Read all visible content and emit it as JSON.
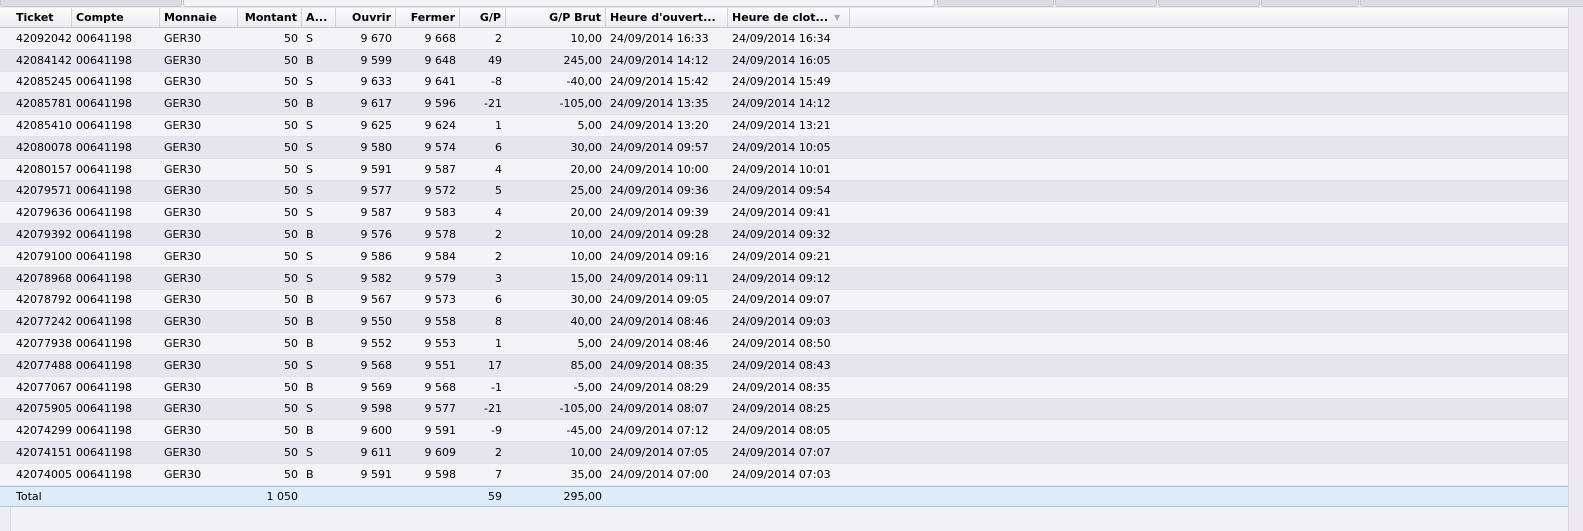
{
  "columns": [
    "Ticket",
    "Compte",
    "Monnaie",
    "Montant",
    "A...",
    "Ouvrir",
    "Fermer",
    "G/P",
    "G/P Brut",
    "Heure d'ouvert...",
    "Heure de clot..."
  ],
  "sort_icon": "▼",
  "rows": [
    [
      "42092042",
      "00641198",
      "GER30",
      "50",
      "S",
      "9 670",
      "9 668",
      "2",
      "10,00",
      "24/09/2014 16:33",
      "24/09/2014 16:34"
    ],
    [
      "42084142",
      "00641198",
      "GER30",
      "50",
      "B",
      "9 599",
      "9 648",
      "49",
      "245,00",
      "24/09/2014 14:12",
      "24/09/2014 16:05"
    ],
    [
      "42085245",
      "00641198",
      "GER30",
      "50",
      "S",
      "9 633",
      "9 641",
      "-8",
      "-40,00",
      "24/09/2014 15:42",
      "24/09/2014 15:49"
    ],
    [
      "42085781",
      "00641198",
      "GER30",
      "50",
      "B",
      "9 617",
      "9 596",
      "-21",
      "-105,00",
      "24/09/2014 13:35",
      "24/09/2014 14:12"
    ],
    [
      "42085410",
      "00641198",
      "GER30",
      "50",
      "S",
      "9 625",
      "9 624",
      "1",
      "5,00",
      "24/09/2014 13:20",
      "24/09/2014 13:21"
    ],
    [
      "42080078",
      "00641198",
      "GER30",
      "50",
      "S",
      "9 580",
      "9 574",
      "6",
      "30,00",
      "24/09/2014 09:57",
      "24/09/2014 10:05"
    ],
    [
      "42080157",
      "00641198",
      "GER30",
      "50",
      "S",
      "9 591",
      "9 587",
      "4",
      "20,00",
      "24/09/2014 10:00",
      "24/09/2014 10:01"
    ],
    [
      "42079571",
      "00641198",
      "GER30",
      "50",
      "S",
      "9 577",
      "9 572",
      "5",
      "25,00",
      "24/09/2014 09:36",
      "24/09/2014 09:54"
    ],
    [
      "42079636",
      "00641198",
      "GER30",
      "50",
      "S",
      "9 587",
      "9 583",
      "4",
      "20,00",
      "24/09/2014 09:39",
      "24/09/2014 09:41"
    ],
    [
      "42079392",
      "00641198",
      "GER30",
      "50",
      "B",
      "9 576",
      "9 578",
      "2",
      "10,00",
      "24/09/2014 09:28",
      "24/09/2014 09:32"
    ],
    [
      "42079100",
      "00641198",
      "GER30",
      "50",
      "S",
      "9 586",
      "9 584",
      "2",
      "10,00",
      "24/09/2014 09:16",
      "24/09/2014 09:21"
    ],
    [
      "42078968",
      "00641198",
      "GER30",
      "50",
      "S",
      "9 582",
      "9 579",
      "3",
      "15,00",
      "24/09/2014 09:11",
      "24/09/2014 09:12"
    ],
    [
      "42078792",
      "00641198",
      "GER30",
      "50",
      "B",
      "9 567",
      "9 573",
      "6",
      "30,00",
      "24/09/2014 09:05",
      "24/09/2014 09:07"
    ],
    [
      "42077242",
      "00641198",
      "GER30",
      "50",
      "B",
      "9 550",
      "9 558",
      "8",
      "40,00",
      "24/09/2014 08:46",
      "24/09/2014 09:03"
    ],
    [
      "42077938",
      "00641198",
      "GER30",
      "50",
      "B",
      "9 552",
      "9 553",
      "1",
      "5,00",
      "24/09/2014 08:46",
      "24/09/2014 08:50"
    ],
    [
      "42077488",
      "00641198",
      "GER30",
      "50",
      "S",
      "9 568",
      "9 551",
      "17",
      "85,00",
      "24/09/2014 08:35",
      "24/09/2014 08:43"
    ],
    [
      "42077067",
      "00641198",
      "GER30",
      "50",
      "B",
      "9 569",
      "9 568",
      "-1",
      "-5,00",
      "24/09/2014 08:29",
      "24/09/2014 08:35"
    ],
    [
      "42075905",
      "00641198",
      "GER30",
      "50",
      "S",
      "9 598",
      "9 577",
      "-21",
      "-105,00",
      "24/09/2014 08:07",
      "24/09/2014 08:25"
    ],
    [
      "42074299",
      "00641198",
      "GER30",
      "50",
      "B",
      "9 600",
      "9 591",
      "-9",
      "-45,00",
      "24/09/2014 07:12",
      "24/09/2014 08:05"
    ],
    [
      "42074151",
      "00641198",
      "GER30",
      "50",
      "S",
      "9 611",
      "9 609",
      "2",
      "10,00",
      "24/09/2014 07:05",
      "24/09/2014 07:07"
    ],
    [
      "42074005",
      "00641198",
      "GER30",
      "50",
      "B",
      "9 591",
      "9 598",
      "7",
      "35,00",
      "24/09/2014 07:00",
      "24/09/2014 07:03"
    ]
  ],
  "total": {
    "label": "Total",
    "montant": "1 050",
    "gp": "59",
    "gp_brut": "295,00"
  }
}
